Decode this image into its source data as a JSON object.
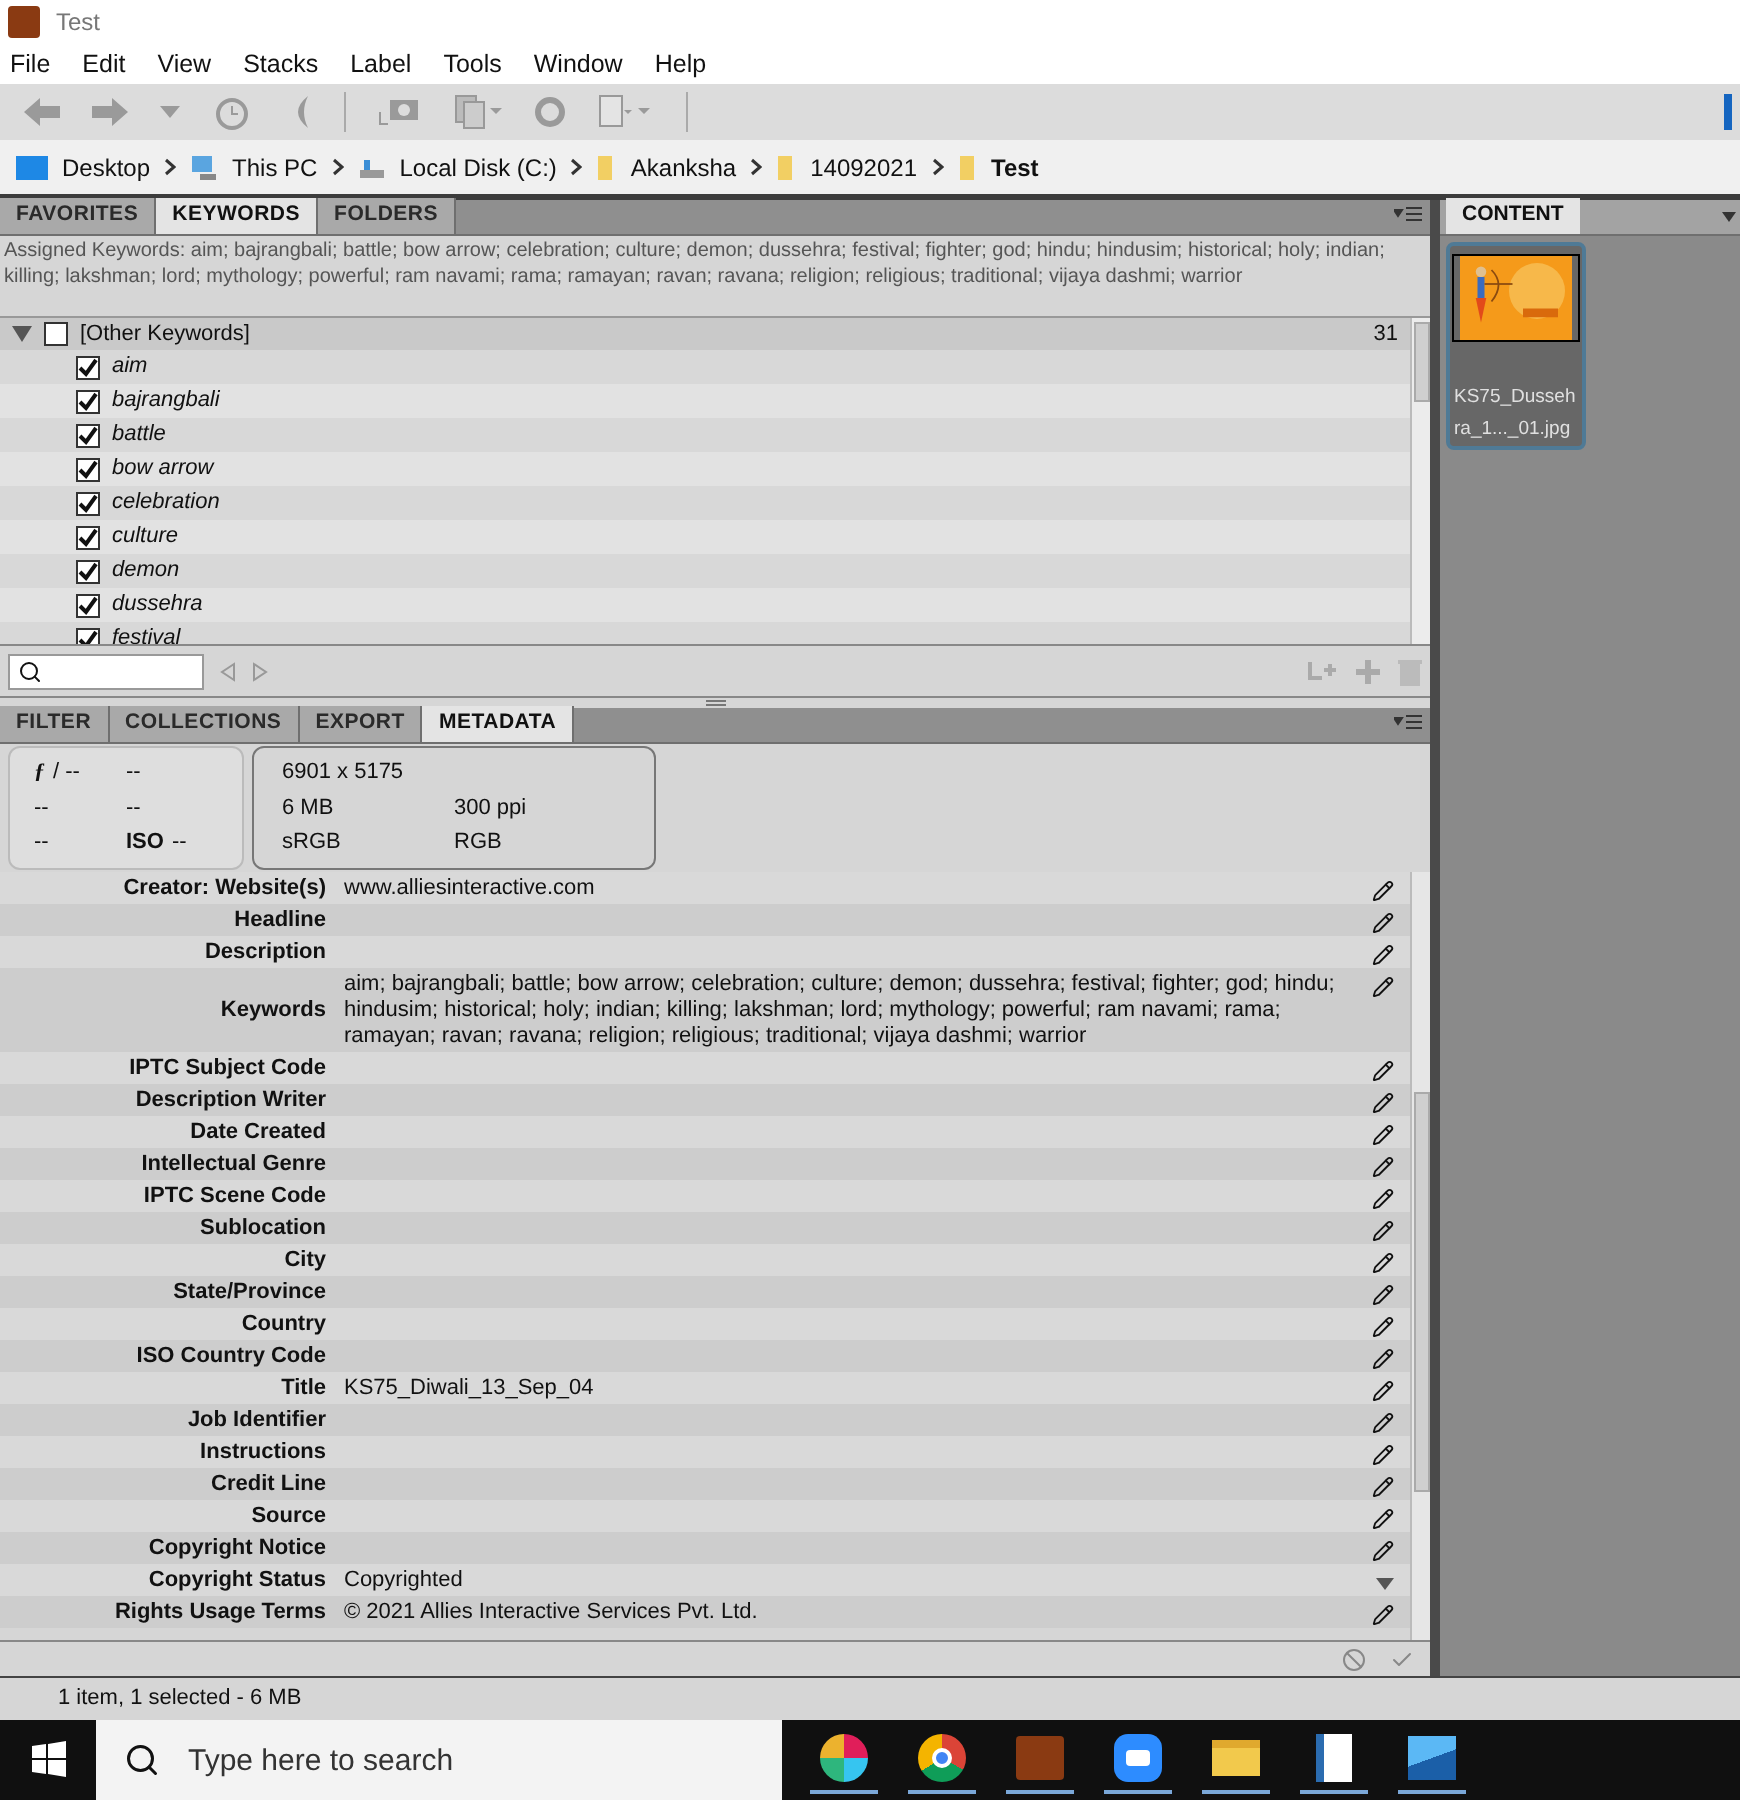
{
  "window": {
    "title": "Test"
  },
  "menu": [
    "File",
    "Edit",
    "View",
    "Stacks",
    "Label",
    "Tools",
    "Window",
    "Help"
  ],
  "breadcrumb": [
    {
      "label": "Desktop",
      "kind": "desktop",
      "current": false
    },
    {
      "label": "This PC",
      "kind": "pc",
      "current": false
    },
    {
      "label": "Local Disk (C:)",
      "kind": "disk",
      "current": false
    },
    {
      "label": "Akanksha",
      "kind": "folder",
      "current": false
    },
    {
      "label": "14092021",
      "kind": "folder",
      "current": false
    },
    {
      "label": "Test",
      "kind": "folder",
      "current": true
    }
  ],
  "top_tabs": [
    {
      "label": "FAVORITES",
      "selected": false
    },
    {
      "label": "KEYWORDS",
      "selected": true
    },
    {
      "label": "FOLDERS",
      "selected": false
    }
  ],
  "assigned_keywords": "Assigned Keywords: aim; bajrangbali; battle; bow arrow; celebration; culture; demon; dussehra; festival; fighter; god; hindu; hindusim; historical; holy; indian; killing; lakshman; lord; mythology; powerful; ram navami; rama; ramayan; ravan; ravana; religion; religious; traditional; vijaya dashmi; warrior",
  "keyword_group": {
    "label": "[Other Keywords]",
    "count": "31",
    "expanded": true,
    "checked": false,
    "children": [
      {
        "label": "aim",
        "checked": true
      },
      {
        "label": "bajrangbali",
        "checked": true
      },
      {
        "label": "battle",
        "checked": true
      },
      {
        "label": "bow arrow",
        "checked": true
      },
      {
        "label": "celebration",
        "checked": true
      },
      {
        "label": "culture",
        "checked": true
      },
      {
        "label": "demon",
        "checked": true
      },
      {
        "label": "dussehra",
        "checked": true
      },
      {
        "label": "festival",
        "checked": true
      }
    ]
  },
  "bottom_tabs": [
    {
      "label": "FILTER",
      "selected": false
    },
    {
      "label": "COLLECTIONS",
      "selected": false
    },
    {
      "label": "EXPORT",
      "selected": false
    },
    {
      "label": "METADATA",
      "selected": true
    }
  ],
  "camera_info": {
    "aperture_symbol": "ƒ",
    "aperture": "/ --",
    "shutter": "--",
    "row2_left": "--",
    "row2_right": "--",
    "row3_left": "--",
    "iso": "ISO",
    "iso_value": "--"
  },
  "file_info": {
    "dimensions": "6901 x 5175",
    "size": "6 MB",
    "resolution": "300 ppi",
    "profile": "sRGB",
    "mode": "RGB"
  },
  "metadata_rows": [
    {
      "label": "Creator: Website(s)",
      "value": "www.alliesinteractive.com",
      "kind": "edit"
    },
    {
      "label": "Headline",
      "kind": "edit"
    },
    {
      "label": "Description",
      "kind": "edit"
    },
    {
      "label": "Keywords",
      "value": "aim; bajrangbali; battle; bow arrow; celebration; culture; demon; dussehra; festival; fighter; god; hindu; hindusim; historical; holy; indian; killing; lakshman; lord; mythology; powerful; ram navami; rama; ramayan; ravan; ravana; religion; religious; traditional; vijaya dashmi; warrior",
      "kind": "edit"
    },
    {
      "label": "IPTC Subject Code",
      "kind": "edit"
    },
    {
      "label": "Description Writer",
      "kind": "edit"
    },
    {
      "label": "Date Created",
      "kind": "edit"
    },
    {
      "label": "Intellectual Genre",
      "kind": "edit"
    },
    {
      "label": "IPTC Scene Code",
      "kind": "edit"
    },
    {
      "label": "Sublocation",
      "kind": "edit"
    },
    {
      "label": "City",
      "kind": "edit"
    },
    {
      "label": "State/Province",
      "kind": "edit"
    },
    {
      "label": "Country",
      "kind": "edit"
    },
    {
      "label": "ISO Country Code",
      "kind": "edit"
    },
    {
      "label": "Title",
      "value": "KS75_Diwali_13_Sep_04",
      "kind": "edit"
    },
    {
      "label": "Job Identifier",
      "kind": "edit"
    },
    {
      "label": "Instructions",
      "kind": "edit"
    },
    {
      "label": "Credit Line",
      "kind": "edit"
    },
    {
      "label": "Source",
      "kind": "edit"
    },
    {
      "label": "Copyright Notice",
      "kind": "edit"
    },
    {
      "label": "Copyright Status",
      "value": "Copyrighted",
      "kind": "menu"
    },
    {
      "label": "Rights Usage Terms",
      "value": "© 2021 Allies Interactive Services Pvt. Ltd.",
      "kind": "edit"
    }
  ],
  "content": {
    "tab": "CONTENT",
    "items": [
      {
        "name": "KS75_Dusseh ra_1..._01.jpg",
        "selected": true,
        "kind": "picture"
      }
    ]
  },
  "status_bar": "1 item, 1 selected - 6 MB",
  "taskbar": {
    "search_placeholder": "Type here to search"
  }
}
